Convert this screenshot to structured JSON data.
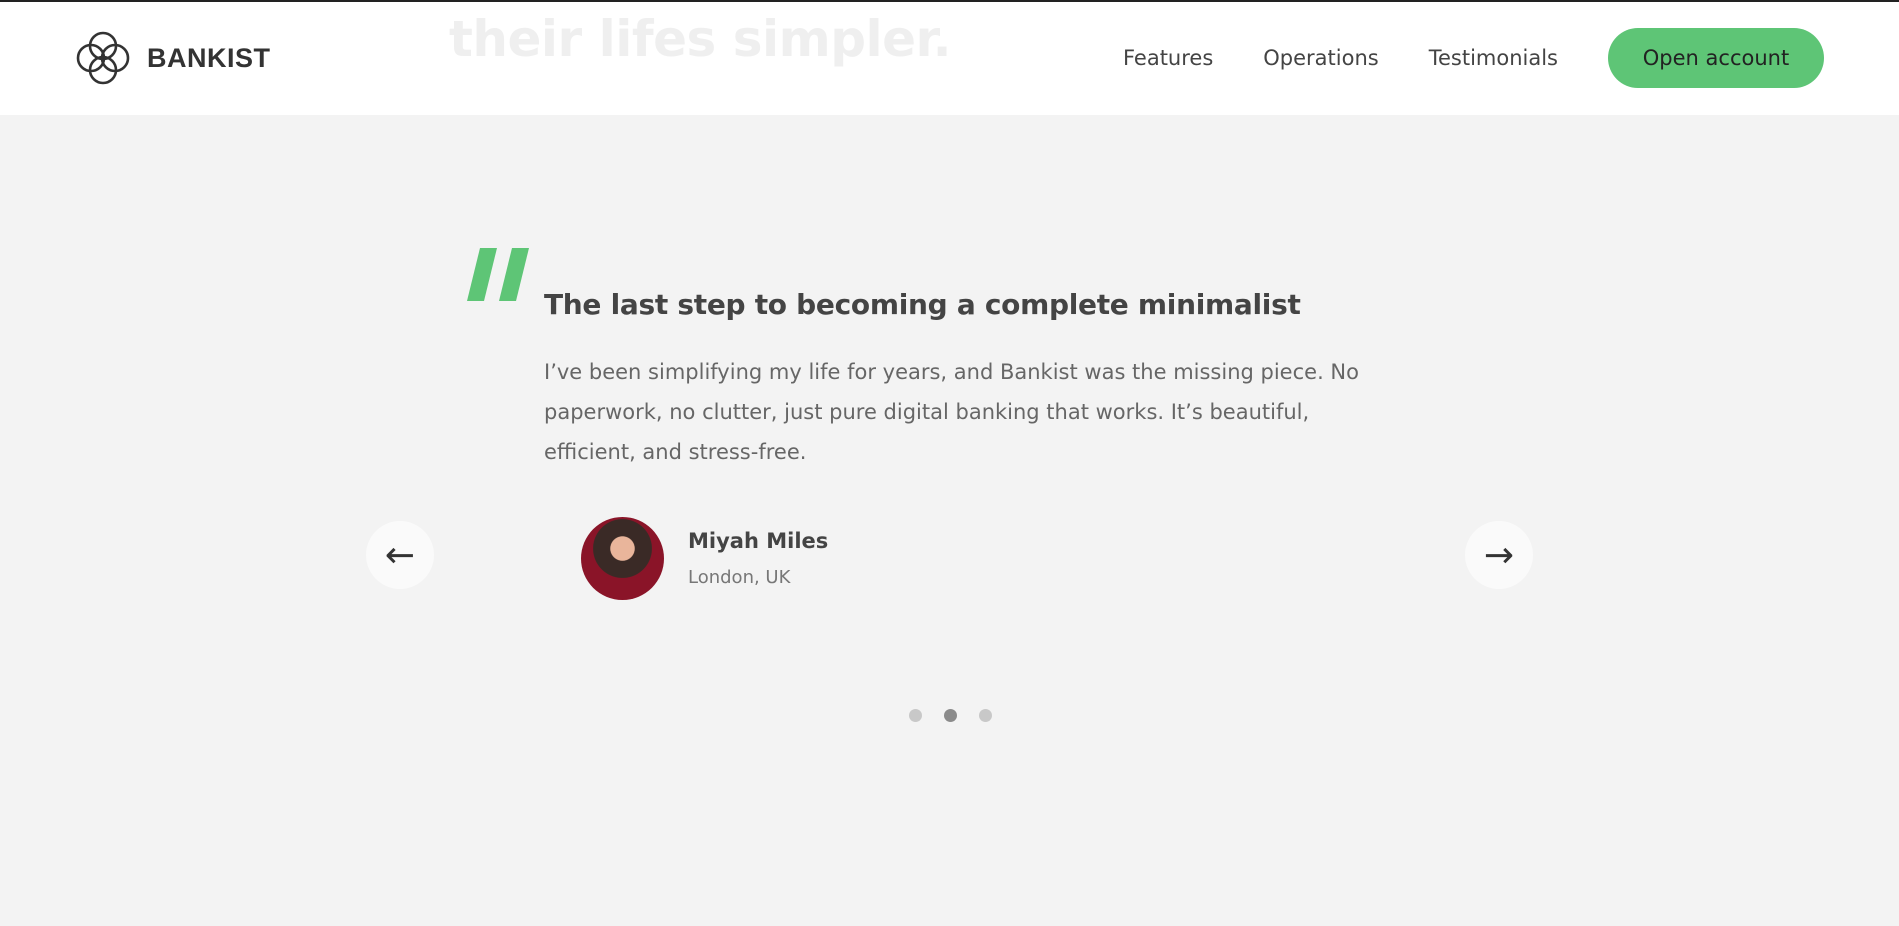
{
  "header": {
    "ghost_heading": "their lifes simpler.",
    "logo_text": "BANKIST",
    "nav": [
      {
        "label": "Features"
      },
      {
        "label": "Operations"
      },
      {
        "label": "Testimonials"
      }
    ],
    "cta_label": "Open account"
  },
  "testimonial": {
    "heading": "The last step to becoming a complete minimalist",
    "text": "I’ve been simplifying my life for years, and Bankist was the missing piece. No paperwork, no clutter, just pure digital banking that works. It’s beautiful, efficient, and stress-free.",
    "author_name": "Miyah Miles",
    "author_location": "London, UK"
  },
  "slider": {
    "prev_glyph": "←",
    "next_glyph": "→",
    "dot_count": 3,
    "active_dot": 2
  },
  "colors": {
    "accent": "#5ec576",
    "background": "#f3f3f3",
    "header_background": "#ffffff",
    "dot_inactive": "#c8c8c8",
    "dot_active": "#8b8b8b"
  }
}
